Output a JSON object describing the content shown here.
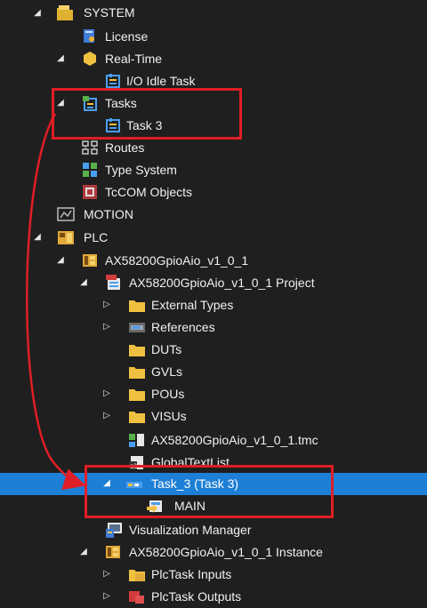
{
  "tree": [
    {
      "label": "SYSTEM",
      "toggle": "◢",
      "icon": "system-folder-icon"
    },
    {
      "label": "License",
      "toggle": "",
      "icon": "license-icon"
    },
    {
      "label": "Real-Time",
      "toggle": "◢",
      "icon": "realtime-icon"
    },
    {
      "label": "I/O Idle Task",
      "toggle": "",
      "icon": "task-icon"
    },
    {
      "label": "Tasks",
      "toggle": "◢",
      "icon": "tasks-icon"
    },
    {
      "label": "Task 3",
      "toggle": "",
      "icon": "task-icon"
    },
    {
      "label": "Routes",
      "toggle": "",
      "icon": "routes-icon"
    },
    {
      "label": "Type System",
      "toggle": "",
      "icon": "type-system-icon"
    },
    {
      "label": "TcCOM Objects",
      "toggle": "",
      "icon": "tccom-icon"
    },
    {
      "label": "MOTION",
      "toggle": "",
      "icon": "motion-icon"
    },
    {
      "label": "PLC",
      "toggle": "◢",
      "icon": "plc-icon"
    },
    {
      "label": "AX58200GpioAio_v1_0_1",
      "toggle": "◢",
      "icon": "plc-project-icon"
    },
    {
      "label": "AX58200GpioAio_v1_0_1 Project",
      "toggle": "◢",
      "icon": "plc-file-icon"
    },
    {
      "label": "External Types",
      "toggle": "▷",
      "icon": "folder-icon"
    },
    {
      "label": "References",
      "toggle": "▷",
      "icon": "references-icon"
    },
    {
      "label": "DUTs",
      "toggle": "",
      "icon": "folder-icon"
    },
    {
      "label": "GVLs",
      "toggle": "",
      "icon": "folder-icon"
    },
    {
      "label": "POUs",
      "toggle": "▷",
      "icon": "folder-icon"
    },
    {
      "label": "VISUs",
      "toggle": "▷",
      "icon": "folder-icon"
    },
    {
      "label": "AX58200GpioAio_v1_0_1.tmc",
      "toggle": "",
      "icon": "tmc-icon"
    },
    {
      "label": "GlobalTextList",
      "toggle": "",
      "icon": "textlist-icon"
    },
    {
      "label": "Task_3 (Task 3)",
      "toggle": "◢",
      "icon": "plc-task-icon"
    },
    {
      "label": "MAIN",
      "toggle": "",
      "icon": "program-icon"
    },
    {
      "label": "Visualization Manager",
      "toggle": "",
      "icon": "visu-manager-icon"
    },
    {
      "label": "AX58200GpioAio_v1_0_1 Instance",
      "toggle": "◢",
      "icon": "instance-icon"
    },
    {
      "label": "PlcTask Inputs",
      "toggle": "▷",
      "icon": "inputs-icon"
    },
    {
      "label": "PlcTask Outputs",
      "toggle": "▷",
      "icon": "outputs-icon"
    }
  ],
  "colors": {
    "background": "#1f1f1f",
    "selection": "#1e7fd6",
    "highlight": "#e01e25",
    "folder": "#f0c040"
  }
}
